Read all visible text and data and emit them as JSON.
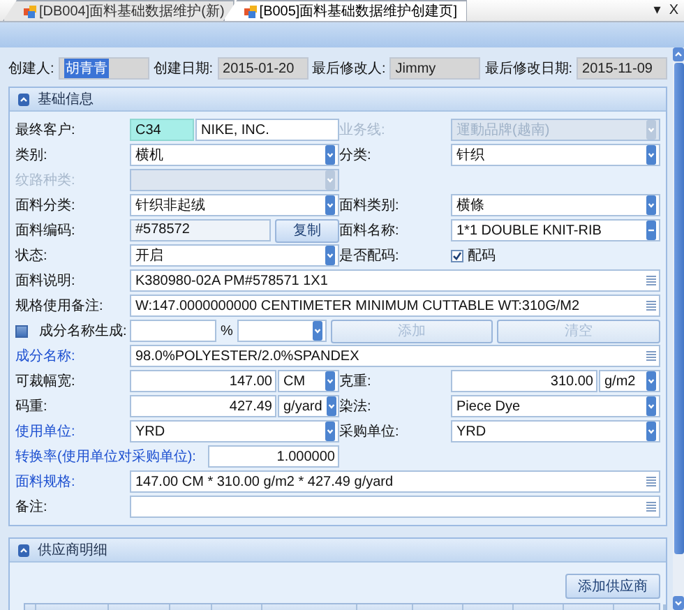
{
  "tabs": [
    {
      "label": "[DB004]面料基础数据维护(新)",
      "selected": false
    },
    {
      "label": "[B005]面料基础数据维护创建页]",
      "selected": true
    }
  ],
  "tab_menu": "▾",
  "tab_close": "X",
  "header_fields": [
    {
      "label": "创建人:",
      "value": "胡青青",
      "highlighted": true
    },
    {
      "label": "创建日期:",
      "value": "2015-01-20",
      "highlighted": false
    },
    {
      "label": "最后修改人:",
      "value": "Jimmy",
      "highlighted": false
    },
    {
      "label": "最后修改日期:",
      "value": "2015-11-09",
      "highlighted": false
    }
  ],
  "basic_info": {
    "title": "基础信息",
    "rows": [
      {
        "kind": "pair",
        "cells": [
          {
            "label": {
              "text": "最终客户:",
              "kind": "plain"
            },
            "field": {
              "kind": "code",
              "code": "C34",
              "name": "NIKE, INC."
            }
          },
          {
            "label": {
              "text": "业务线:",
              "kind": "disabled"
            },
            "field": {
              "kind": "select",
              "value": "運動品牌(越南)",
              "disabled": true
            }
          }
        ]
      },
      {
        "kind": "pair",
        "cells": [
          {
            "label": {
              "text": "类别:",
              "kind": "plain"
            },
            "field": {
              "kind": "select",
              "value": "横机",
              "disabled": false
            }
          },
          {
            "label": {
              "text": "分类:",
              "kind": "plain"
            },
            "field": {
              "kind": "select",
              "value": "针织",
              "disabled": false
            }
          }
        ]
      },
      {
        "kind": "pair",
        "cells": [
          {
            "label": {
              "text": "纹路种类:",
              "kind": "disabled"
            },
            "field": {
              "kind": "select",
              "disabled": true
            }
          }
        ]
      },
      {
        "kind": "pair",
        "cells": [
          {
            "label": {
              "text": "面料分类:",
              "kind": "plain"
            },
            "field": {
              "kind": "select",
              "value": "针织非起绒",
              "disabled": false
            }
          },
          {
            "label": {
              "text": "面料类别:",
              "kind": "plain"
            },
            "field": {
              "kind": "select",
              "value": "横條",
              "disabled": false
            }
          }
        ]
      },
      {
        "kind": "pair",
        "cells": [
          {
            "label": {
              "text": "面料编码:",
              "kind": "plain"
            },
            "field": {
              "kind": "text_button",
              "value": "#578572",
              "button": "复制"
            }
          },
          {
            "label": {
              "text": "面料名称:",
              "kind": "plain"
            },
            "field": {
              "kind": "picker",
              "value": "1*1 DOUBLE KNIT-RIB"
            }
          }
        ]
      },
      {
        "kind": "pair",
        "cells": [
          {
            "label": {
              "text": "状态:",
              "kind": "plain"
            },
            "field": {
              "kind": "select",
              "value": "开启",
              "disabled": false
            }
          },
          {
            "label": {
              "text": "是否配码:",
              "kind": "plain"
            },
            "field": {
              "kind": "checkbox",
              "checked": true,
              "text": "配码"
            }
          }
        ]
      },
      {
        "kind": "full",
        "label": {
          "text": "面料说明:",
          "kind": "plain"
        },
        "field": {
          "kind": "memo",
          "value": "K380980-02A    PM#578571    1X1"
        }
      },
      {
        "kind": "full",
        "label": {
          "text": "规格使用备注:",
          "kind": "plain"
        },
        "field": {
          "kind": "memo",
          "value": "W:147.0000000000 CENTIMETER   MINIMUM CUTTABLE   WT:310G/M2"
        }
      },
      {
        "kind": "composition",
        "label": "成分名称生成:",
        "checked": false,
        "percent": "%",
        "buttons": [
          {
            "label": "添加",
            "disabled": true
          },
          {
            "label": "清空",
            "disabled": true
          }
        ]
      },
      {
        "kind": "full",
        "label": {
          "text": "成分名称:",
          "kind": "link"
        },
        "field": {
          "kind": "memo",
          "value": "98.0%POLYESTER/2.0%SPANDEX"
        }
      },
      {
        "kind": "pair",
        "cells": [
          {
            "label": {
              "text": "可裁幅宽:",
              "kind": "plain"
            },
            "field": {
              "kind": "number_unit",
              "value": "147.00",
              "unit": "CM"
            }
          },
          {
            "label": {
              "text": "克重:",
              "kind": "plain"
            },
            "field": {
              "kind": "number_unit",
              "value": "310.00",
              "unit": "g/m2"
            }
          }
        ]
      },
      {
        "kind": "pair",
        "cells": [
          {
            "label": {
              "text": "码重:",
              "kind": "plain"
            },
            "field": {
              "kind": "number_unit",
              "value": "427.49",
              "unit": "g/yard"
            }
          },
          {
            "label": {
              "text": "染法:",
              "kind": "plain"
            },
            "field": {
              "kind": "select",
              "value": "Piece Dye",
              "disabled": false
            }
          }
        ]
      },
      {
        "kind": "pair",
        "cells": [
          {
            "label": {
              "text": "使用单位:",
              "kind": "link"
            },
            "field": {
              "kind": "select",
              "value": "YRD",
              "disabled": false
            }
          },
          {
            "label": {
              "text": "采购单位:",
              "kind": "plain"
            },
            "field": {
              "kind": "select",
              "value": "YRD",
              "disabled": false
            }
          }
        ]
      },
      {
        "kind": "wide",
        "label": {
          "text": "转换率(使用单位对采购单位):",
          "kind": "link"
        },
        "field": {
          "kind": "number",
          "value": "1.000000"
        }
      },
      {
        "kind": "full",
        "label": {
          "text": "面料规格:",
          "kind": "link"
        },
        "field": {
          "kind": "memo",
          "value": "147.00 CM * 310.00 g/m2 * 427.49 g/yard"
        }
      },
      {
        "kind": "full",
        "label": {
          "text": "备注:",
          "kind": "plain"
        },
        "field": {
          "kind": "memo"
        }
      }
    ]
  },
  "suppliers": {
    "title": "供应商明细",
    "button": "添加供应商"
  }
}
